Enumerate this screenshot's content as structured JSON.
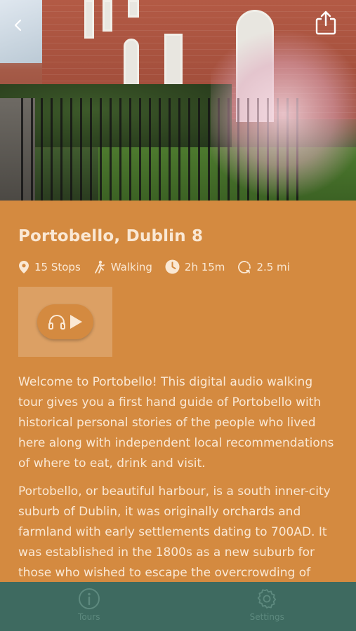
{
  "header": {
    "back_icon": "chevron-left-icon",
    "share_icon": "share-icon"
  },
  "tour": {
    "title": "Portobello, Dublin 8",
    "stats": {
      "stops": "15 Stops",
      "mode": "Walking",
      "duration": "2h 15m",
      "distance": "2.5 mi"
    },
    "player_icons": [
      "headphones-icon",
      "play-icon"
    ],
    "description": [
      "Welcome to Portobello! This digital audio walking tour gives you a first hand guide of Portobello with historical personal stories of the people who lived here along with independent local recommendations of where to eat, drink and visit.",
      "Portobello, or beautiful harbour, is a south inner-city suburb of Dublin, it was originally orchards and farmland with early settlements dating to 700AD. It was established in the 1800s as a new suburb for those who wished to escape the overcrowding of"
    ]
  },
  "tabbar": {
    "tabs": [
      {
        "label": "Tours",
        "icon": "info-icon"
      },
      {
        "label": "Settings",
        "icon": "gear-icon"
      }
    ]
  },
  "colors": {
    "background": "#d48a40",
    "text": "#fae8d4",
    "tabbar": "#3e6a60",
    "tab_inactive": "#5e8a7f"
  }
}
